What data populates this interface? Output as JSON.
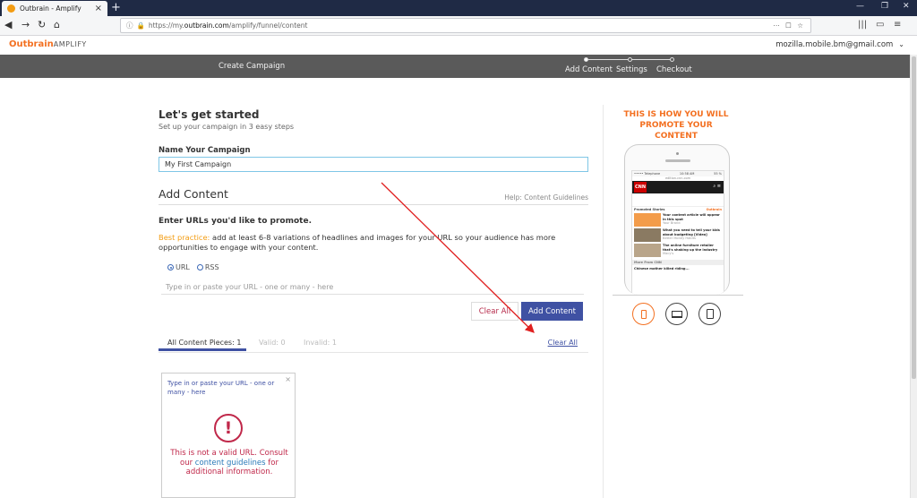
{
  "browser": {
    "tab_title": "Outbrain - Amplify",
    "url_prefix": "https://my.",
    "url_domain": "outbrain.com",
    "url_path": "/amplify/funnel/content"
  },
  "header": {
    "logo_main": "Outbrain",
    "logo_sub": "AMPLIFY",
    "account_email": "mozilla.mobile.bm@gmail.com"
  },
  "nav": {
    "create_campaign": "Create Campaign",
    "steps": [
      "Add Content",
      "Settings",
      "Checkout"
    ]
  },
  "form": {
    "title": "Let's get started",
    "subtitle": "Set up your campaign in 3 easy steps",
    "name_label": "Name Your Campaign",
    "name_value": "My First Campaign",
    "add_content_title": "Add Content",
    "help_link": "Help: Content Guidelines",
    "enter_urls_label": "Enter URLs you'd like to promote.",
    "best_practice_label": "Best practice:",
    "best_practice_text": " add at least 6-8 variations of headlines and images for your URL so your audience has more opportunities to engage with your content.",
    "radio_url": "URL",
    "radio_rss": "RSS",
    "url_placeholder": "Type in or paste your URL - one or many - here",
    "clear_all_button": "Clear All",
    "add_content_button": "Add Content"
  },
  "content_tabs": {
    "all": "All Content Pieces: 1",
    "valid": "Valid: 0",
    "invalid": "Invalid: 1",
    "clear_all_link": "Clear All"
  },
  "card": {
    "url_text": "Type in or paste your URL - one or many - here",
    "close": "×",
    "error_icon": "!",
    "msg_before": "This is not a valid URL. Consult our ",
    "msg_link": "content guidelines",
    "msg_after": " for additional information."
  },
  "preview": {
    "title": "THIS IS HOW YOU WILL PROMOTE YOUR CONTENT",
    "phone": {
      "carrier": "••••• Telephone",
      "time": "10:58 AM",
      "battery": "55 %",
      "address": "edition.cnn.com",
      "brand": "CNN",
      "promoted": "Promoted Stories",
      "ob": "Outbrain",
      "stories": [
        {
          "title": "Your content article will appear in this spot",
          "source": "Your Brand"
        },
        {
          "title": "What you need to tell your kids about budgeting [Video]",
          "source": "Better Money Habits"
        },
        {
          "title": "The online furniture retailer that's shaking up the industry",
          "source": "Macy's"
        }
      ],
      "more": "More From CNN",
      "more_item": "Chinese mother killed riding..."
    }
  },
  "colors": {
    "brand_orange": "#f37021",
    "primary_blue": "#3f51a3",
    "error_red": "#c0284a"
  }
}
